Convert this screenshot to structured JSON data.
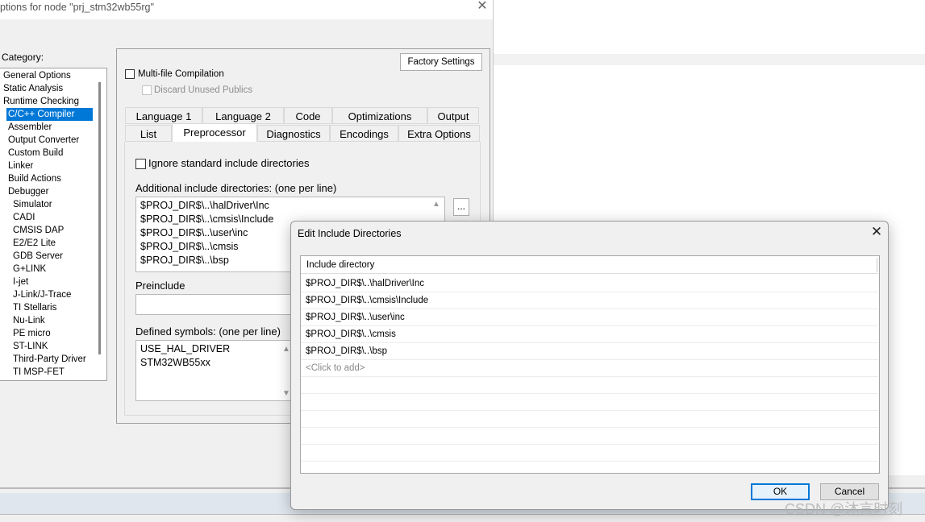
{
  "options_dialog": {
    "title": "ptions for node \"prj_stm32wb55rg\"",
    "close": "✕",
    "category_label": "Category:",
    "categories": [
      {
        "label": "General Options",
        "level": 0
      },
      {
        "label": "Static Analysis",
        "level": 0
      },
      {
        "label": "Runtime Checking",
        "level": 0
      },
      {
        "label": "C/C++ Compiler",
        "level": 1,
        "selected": true
      },
      {
        "label": "Assembler",
        "level": 1
      },
      {
        "label": "Output Converter",
        "level": 1
      },
      {
        "label": "Custom Build",
        "level": 1
      },
      {
        "label": "Linker",
        "level": 1
      },
      {
        "label": "Build Actions",
        "level": 1
      },
      {
        "label": "Debugger",
        "level": 1
      },
      {
        "label": "Simulator",
        "level": 2
      },
      {
        "label": "CADI",
        "level": 2
      },
      {
        "label": "CMSIS DAP",
        "level": 2
      },
      {
        "label": "E2/E2 Lite",
        "level": 2
      },
      {
        "label": "GDB Server",
        "level": 2
      },
      {
        "label": "G+LINK",
        "level": 2
      },
      {
        "label": "I-jet",
        "level": 2
      },
      {
        "label": "J-Link/J-Trace",
        "level": 2
      },
      {
        "label": "TI Stellaris",
        "level": 2
      },
      {
        "label": "Nu-Link",
        "level": 2
      },
      {
        "label": "PE micro",
        "level": 2
      },
      {
        "label": "ST-LINK",
        "level": 2
      },
      {
        "label": "Third-Party Driver",
        "level": 2
      },
      {
        "label": "TI MSP-FET",
        "level": 2
      }
    ],
    "factory_settings": "Factory Settings",
    "multi_file_compilation": "Multi-file Compilation",
    "discard_unused_publics": "Discard Unused Publics",
    "tabs_row1": [
      "Language 1",
      "Language 2",
      "Code",
      "Optimizations",
      "Output"
    ],
    "tabs_row2": [
      "List",
      "Preprocessor",
      "Diagnostics",
      "Encodings",
      "Extra Options"
    ],
    "active_tab": "Preprocessor",
    "ignore_std_include": "Ignore standard include directories",
    "additional_include_label": "Additional include directories: (one per line)",
    "additional_include_dirs": [
      "$PROJ_DIR$\\..\\halDriver\\Inc",
      "$PROJ_DIR$\\..\\cmsis\\Include",
      "$PROJ_DIR$\\..\\user\\inc",
      "$PROJ_DIR$\\..\\cmsis",
      "$PROJ_DIR$\\..\\bsp"
    ],
    "browse_button": "...",
    "preinclude_label": "Preinclude",
    "defined_symbols_label": "Defined symbols: (one per line)",
    "defined_symbols": [
      "USE_HAL_DRIVER",
      "STM32WB55xx"
    ]
  },
  "edit_dialog": {
    "title": "Edit Include Directories",
    "close": "✕",
    "column_header": "Include directory",
    "rows": [
      "$PROJ_DIR$\\..\\halDriver\\Inc",
      "$PROJ_DIR$\\..\\cmsis\\Include",
      "$PROJ_DIR$\\..\\user\\inc",
      "$PROJ_DIR$\\..\\cmsis",
      "$PROJ_DIR$\\..\\bsp"
    ],
    "click_to_add": "<Click to add>",
    "ok": "OK",
    "cancel": "Cancel"
  },
  "watermark": "CSDN @沐言时刻",
  "colors": {
    "selection": "#0078d7",
    "dialog_bg": "#f0f0f0",
    "ok_border": "#0078d7"
  }
}
